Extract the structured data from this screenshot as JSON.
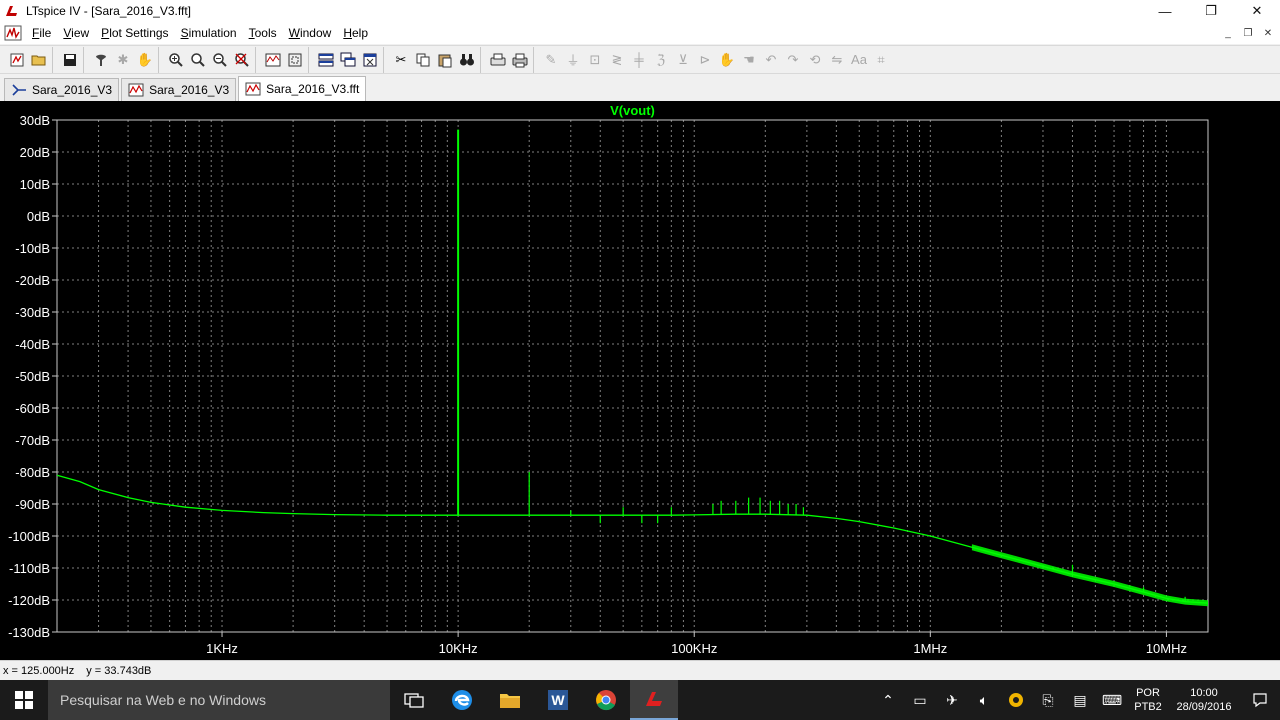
{
  "window": {
    "title": "LTspice IV - [Sara_2016_V3.fft]",
    "controls": {
      "minimize": "—",
      "maximize": "❐",
      "close": "✕"
    }
  },
  "menu": {
    "items": [
      {
        "label": "File",
        "key": "F",
        "rest": "ile"
      },
      {
        "label": "View",
        "key": "V",
        "rest": "iew"
      },
      {
        "label": "Plot Settings",
        "key": "P",
        "rest": "lot Settings"
      },
      {
        "label": "Simulation",
        "key": "S",
        "rest": "imulation"
      },
      {
        "label": "Tools",
        "key": "T",
        "rest": "ools"
      },
      {
        "label": "Window",
        "key": "W",
        "rest": "indow"
      },
      {
        "label": "Help",
        "key": "H",
        "rest": "elp"
      }
    ],
    "mdi": {
      "minimize": "_",
      "restore": "❐",
      "close": "✕"
    }
  },
  "tabs": [
    {
      "label": "Sara_2016_V3",
      "icon": "schematic-icon",
      "active": false
    },
    {
      "label": "Sara_2016_V3",
      "icon": "waveform-icon",
      "active": false
    },
    {
      "label": "Sara_2016_V3.fft",
      "icon": "waveform-icon",
      "active": true
    }
  ],
  "status": {
    "x": "x = 125.000Hz",
    "y": "y = 33.743dB"
  },
  "taskbar": {
    "search_placeholder": "Pesquisar na Web e no Windows",
    "lang_line1": "POR",
    "lang_line2": "PTB2",
    "time": "10:00",
    "date": "28/09/2016"
  },
  "colors": {
    "trace": "#00ff00",
    "grid": "#808080",
    "background": "#000000",
    "title": "#00ff00"
  },
  "chart_data": {
    "type": "line",
    "title": "V(vout)",
    "x_scale": "log",
    "xlim": [
      200,
      15000000
    ],
    "ylim": [
      -130,
      30
    ],
    "y_ticks": [
      30,
      20,
      10,
      0,
      -10,
      -20,
      -30,
      -40,
      -50,
      -60,
      -70,
      -80,
      -90,
      -100,
      -110,
      -120,
      -130
    ],
    "y_tick_labels": [
      "30dB",
      "20dB",
      "10dB",
      "0dB",
      "-10dB",
      "-20dB",
      "-30dB",
      "-40dB",
      "-50dB",
      "-60dB",
      "-70dB",
      "-80dB",
      "-90dB",
      "-100dB",
      "-110dB",
      "-120dB",
      "-130dB"
    ],
    "x_ticks": [
      1000,
      10000,
      100000,
      1000000,
      10000000
    ],
    "x_tick_labels": [
      "1KHz",
      "10KHz",
      "100KHz",
      "1MHz",
      "10MHz"
    ],
    "grid": true,
    "series": [
      {
        "name": "V(vout)",
        "x": [
          200,
          250,
          300,
          400,
          500,
          700,
          1000,
          1500,
          2000,
          3000,
          5000,
          8000,
          10000,
          20000,
          30000,
          50000,
          80000,
          100000,
          150000,
          200000,
          300000,
          400000,
          500000,
          700000,
          1000000,
          1500000,
          2000000,
          3000000,
          4000000,
          6000000,
          8000000,
          10000000,
          12000000,
          15000000
        ],
        "y": [
          -81,
          -83,
          -85.5,
          -88,
          -89.5,
          -91,
          -92,
          -92.7,
          -93,
          -93.3,
          -93.5,
          -93.5,
          -93.5,
          -93.5,
          -93.5,
          -93.5,
          -93.5,
          -93.4,
          -93.2,
          -93.2,
          -93.5,
          -94.5,
          -95.5,
          -97.5,
          -100,
          -103.5,
          -106,
          -109.5,
          -112,
          -115,
          -117.5,
          -119.5,
          -120.5,
          -121
        ]
      }
    ],
    "spikes": [
      {
        "x": 10000,
        "y": 27
      },
      {
        "x": 20000,
        "y": -80
      },
      {
        "x": 30000,
        "y": -92
      },
      {
        "x": 40000,
        "y": -96
      },
      {
        "x": 50000,
        "y": -91
      },
      {
        "x": 60000,
        "y": -96
      },
      {
        "x": 70000,
        "y": -96
      },
      {
        "x": 80000,
        "y": -91
      },
      {
        "x": 120000,
        "y": -90
      },
      {
        "x": 130000,
        "y": -89
      },
      {
        "x": 150000,
        "y": -89
      },
      {
        "x": 170000,
        "y": -88
      },
      {
        "x": 190000,
        "y": -88
      },
      {
        "x": 210000,
        "y": -89
      },
      {
        "x": 230000,
        "y": -89
      },
      {
        "x": 250000,
        "y": -90
      },
      {
        "x": 270000,
        "y": -90
      },
      {
        "x": 290000,
        "y": -91
      },
      {
        "x": 4000000,
        "y": -109
      },
      {
        "x": 8000000,
        "y": -116
      },
      {
        "x": 12000000,
        "y": -119
      }
    ]
  }
}
